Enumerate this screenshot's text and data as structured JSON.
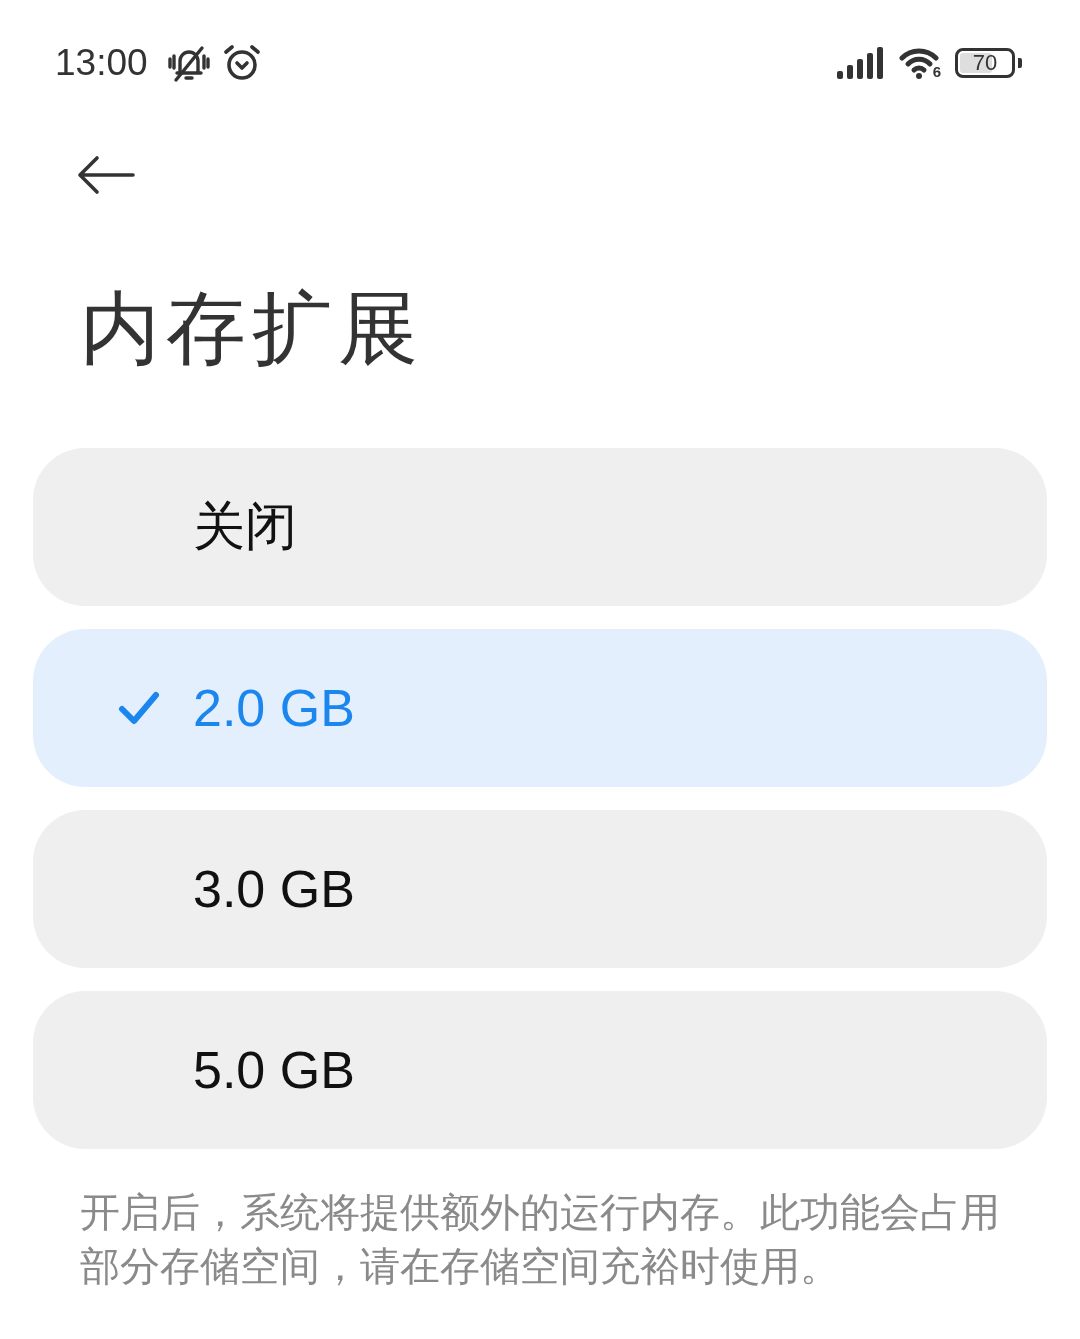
{
  "status_bar": {
    "time": "13:00",
    "wifi_label": "6",
    "battery": "70"
  },
  "header": {
    "title": "内存扩展"
  },
  "options": [
    {
      "label": "关闭",
      "selected": false
    },
    {
      "label": "2.0 GB",
      "selected": true
    },
    {
      "label": "3.0 GB",
      "selected": false
    },
    {
      "label": "5.0 GB",
      "selected": false
    }
  ],
  "description": "开启后，系统将提供额外的运行内存。此功能会占用部分存储空间，请在存储空间充裕时使用。"
}
